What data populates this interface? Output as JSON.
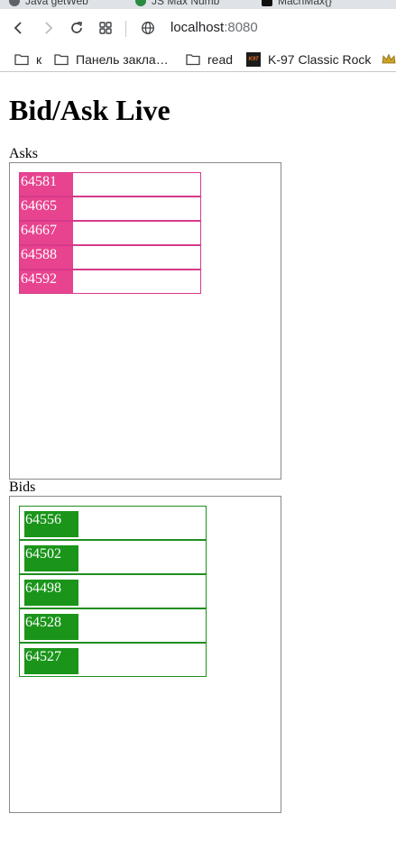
{
  "browser": {
    "tabs": [
      {
        "label": "Java getWeb"
      },
      {
        "label": "JS Max Numb"
      },
      {
        "label": "MachMax{}"
      }
    ],
    "address": {
      "host": "localhost",
      "port": ":8080"
    },
    "bookmarks": [
      {
        "label": "к",
        "icon": "folder-icon"
      },
      {
        "label": "Панель закла…",
        "icon": "folder-icon"
      },
      {
        "label": "read",
        "icon": "folder-icon"
      },
      {
        "label": "K-97 Classic Rock",
        "icon": "k97-logo-icon"
      }
    ],
    "colors": {
      "asks": "#e8438f",
      "bids": "#1a951a"
    }
  },
  "page": {
    "title": "Bid/Ask Live",
    "asks": {
      "label": "Asks",
      "rows": [
        {
          "price": "64581"
        },
        {
          "price": "64665"
        },
        {
          "price": "64667"
        },
        {
          "price": "64588"
        },
        {
          "price": "64592"
        }
      ]
    },
    "bids": {
      "label": "Bids",
      "rows": [
        {
          "price": "64556"
        },
        {
          "price": "64502"
        },
        {
          "price": "64498"
        },
        {
          "price": "64528"
        },
        {
          "price": "64527"
        }
      ]
    }
  }
}
